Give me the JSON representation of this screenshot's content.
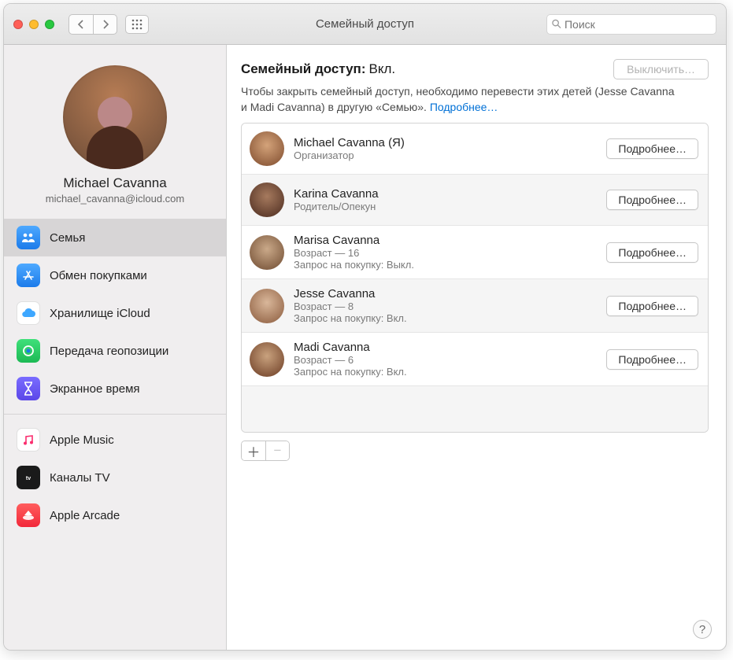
{
  "window": {
    "title": "Семейный доступ"
  },
  "search": {
    "placeholder": "Поиск"
  },
  "profile": {
    "name": "Michael Cavanna",
    "email": "michael_cavanna@icloud.com"
  },
  "sidebar": {
    "items": [
      {
        "label": "Семья"
      },
      {
        "label": "Обмен покупками"
      },
      {
        "label": "Хранилище iCloud"
      },
      {
        "label": "Передача геопозиции"
      },
      {
        "label": "Экранное время"
      },
      {
        "label": "Apple Music"
      },
      {
        "label": "Каналы TV"
      },
      {
        "label": "Apple Arcade"
      }
    ]
  },
  "header": {
    "label": "Семейный доступ:",
    "status": "Вкл.",
    "off_button": "Выключить…"
  },
  "description": {
    "text": "Чтобы закрыть семейный доступ, необходимо перевести этих детей (Jesse Cavanna и Madi Cavanna) в другую «Семью».",
    "link": "Подробнее…"
  },
  "members": [
    {
      "name": "Michael Cavanna (Я)",
      "sub1": "Организатор",
      "sub2": "",
      "button": "Подробнее…"
    },
    {
      "name": "Karina Cavanna",
      "sub1": "Родитель/Опекун",
      "sub2": "",
      "button": "Подробнее…"
    },
    {
      "name": "Marisa Cavanna",
      "sub1": "Возраст — 16",
      "sub2": "Запрос на покупку: Выкл.",
      "button": "Подробнее…"
    },
    {
      "name": "Jesse Cavanna",
      "sub1": "Возраст — 8",
      "sub2": "Запрос на покупку: Вкл.",
      "button": "Подробнее…"
    },
    {
      "name": "Madi Cavanna",
      "sub1": "Возраст — 6",
      "sub2": "Запрос на покупку: Вкл.",
      "button": "Подробнее…"
    }
  ]
}
